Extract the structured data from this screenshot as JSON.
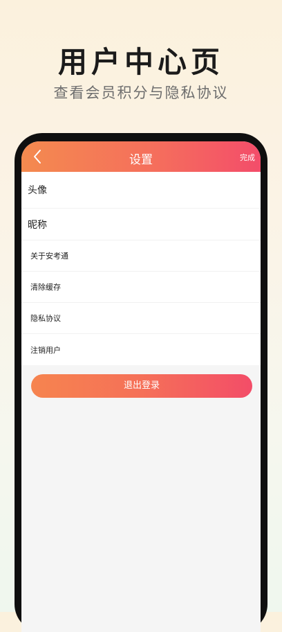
{
  "promo": {
    "title": "用户中心页",
    "subtitle": "查看会员积分与隐私协议"
  },
  "nav": {
    "back_icon": "chevron-left-icon",
    "title": "设置",
    "done_label": "完成"
  },
  "settings": {
    "items": [
      {
        "label": "头像"
      },
      {
        "label": "昵称"
      },
      {
        "label": "关于安考通"
      },
      {
        "label": "清除缓存"
      },
      {
        "label": "隐私协议"
      },
      {
        "label": "注销用户"
      }
    ]
  },
  "logout": {
    "label": "退出登录"
  },
  "colors": {
    "nav_gradient_start": "#f48a4f",
    "nav_gradient_end": "#f34d6a",
    "phone_bezel": "#0f0f0f",
    "screen_background": "#f5f5f5"
  }
}
